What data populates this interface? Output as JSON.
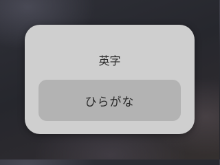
{
  "input_switcher": {
    "options": [
      {
        "label": "英字",
        "selected": false
      },
      {
        "label": "ひらがな",
        "selected": true
      }
    ]
  }
}
